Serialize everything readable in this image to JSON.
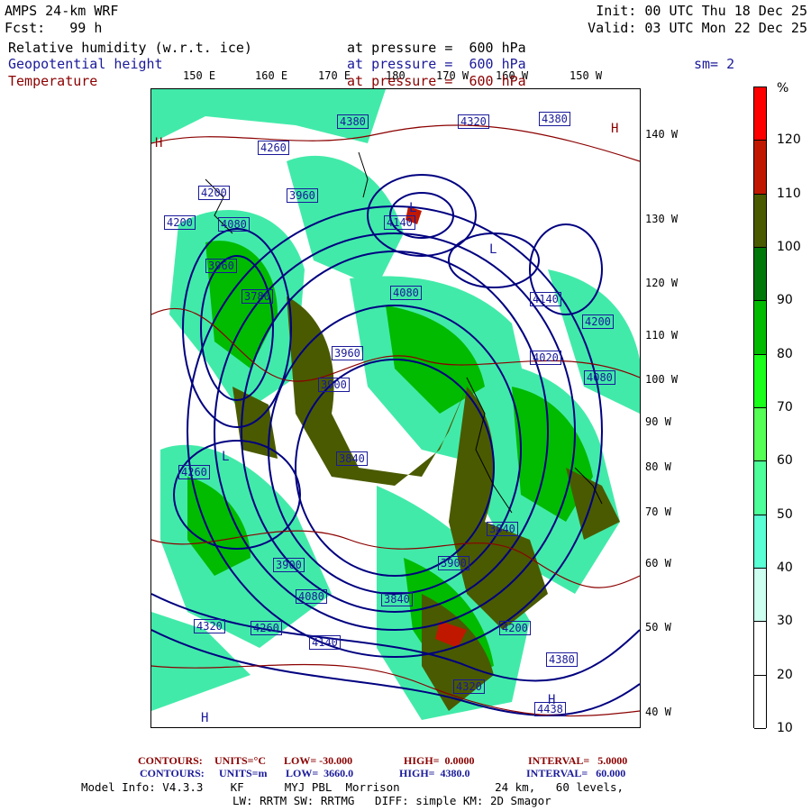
{
  "header": {
    "model": "AMPS 24-km WRF",
    "forecast": "Fcst:   99 h",
    "init": "Init: 00 UTC Thu 18 Dec 25",
    "valid": "Valid: 03 UTC Mon 22 Dec 25"
  },
  "fields": [
    {
      "name": "Relative humidity (w.r.t. ice)",
      "level": "at pressure =  600 hPa",
      "color": "#000000"
    },
    {
      "name": "Geopotential height",
      "level": "at pressure =  600 hPa",
      "color": "#1a1a9a"
    },
    {
      "name": "Temperature",
      "level": "at pressure =  600 hPa",
      "color": "#8b0000"
    }
  ],
  "smoothing": "sm= 2",
  "map": {
    "top_lon_labels": [
      "150 E",
      "160 E",
      "170 E",
      "180",
      "170 W",
      "160 W",
      "150 W"
    ],
    "right_lon_labels": [
      "140 W",
      "130 W",
      "120 W",
      "110 W",
      "100 W",
      "90 W",
      "80 W",
      "70 W",
      "60 W",
      "50 W",
      "40 W"
    ],
    "height_labels": [
      "4380",
      "4320",
      "4380",
      "4260",
      "4200",
      "4200",
      "4080",
      "3960",
      "4140",
      "3960",
      "3780",
      "4080",
      "3960",
      "3900",
      "3840",
      "4260",
      "4140",
      "4020",
      "3840",
      "3900",
      "4320",
      "4260",
      "4140",
      "4200",
      "4320",
      "4380",
      "4438",
      "4080",
      "3900",
      "3840",
      "4080",
      "4200"
    ],
    "extrema_markers": [
      "H",
      "H",
      "H",
      "L",
      "L",
      "L",
      "H"
    ]
  },
  "colorbar": {
    "unit": "%",
    "labels": [
      "120",
      "110",
      "100",
      "90",
      "80",
      "70",
      "60",
      "50",
      "40",
      "30",
      "20",
      "10"
    ],
    "colors": [
      "#ff0000",
      "#c01800",
      "#4a5a00",
      "#00780a",
      "#00bb00",
      "#1aff1a",
      "#55ff55",
      "#4dff9a",
      "#5affd6",
      "#ccfff0",
      "#ffffff",
      "#ffffff",
      "#ffffff"
    ]
  },
  "footer": {
    "temp_contours": {
      "label": "CONTOURS:",
      "units": "UNITS=°C",
      "low": "LOW= -30.000",
      "high": "HIGH=  0.0000",
      "interval": "INTERVAL=   5.0000"
    },
    "height_contours": {
      "label": "CONTOURS:",
      "units": "UNITS=m",
      "low": "LOW=  3660.0",
      "high": "HIGH=  4380.0",
      "interval": "INTERVAL=   60.000"
    },
    "model_info": "Model Info: V4.3.3    KF      MYJ PBL  Morrison              24 km,   60 levels,",
    "physics": "LW: RRTM SW: RRTMG   DIFF: simple KM: 2D Smagor"
  }
}
